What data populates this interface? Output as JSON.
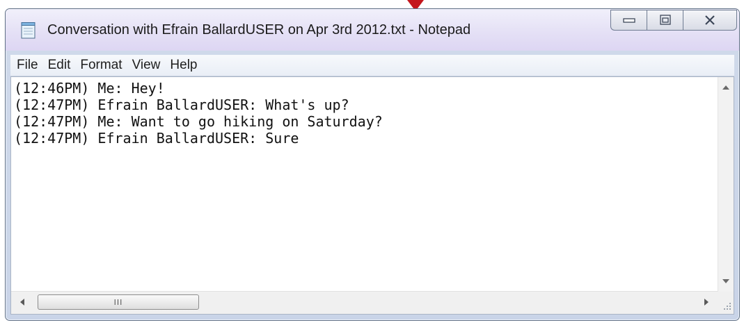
{
  "window": {
    "title": "Conversation with Efrain BallardUSER on Apr 3rd 2012.txt - Notepad",
    "icon": "notepad-icon"
  },
  "window_controls": {
    "minimize_icon": "minimize-icon",
    "maximize_icon": "maximize-icon",
    "close_icon": "close-icon"
  },
  "menubar": {
    "items": [
      {
        "label": "File"
      },
      {
        "label": "Edit"
      },
      {
        "label": "Format"
      },
      {
        "label": "View"
      },
      {
        "label": "Help"
      }
    ]
  },
  "editor": {
    "lines": [
      "(12:46PM) Me: Hey!",
      "(12:47PM) Efrain BallardUSER: What's up?",
      "(12:47PM) Me: Want to go hiking on Saturday?",
      "(12:47PM) Efrain BallardUSER: Sure"
    ]
  },
  "hscroll": {
    "grip_glyph": "III"
  },
  "colors": {
    "pointer_arrow": "#c4161c",
    "title_bar": "#e6e2f6",
    "frame": "#c9d4e8"
  }
}
